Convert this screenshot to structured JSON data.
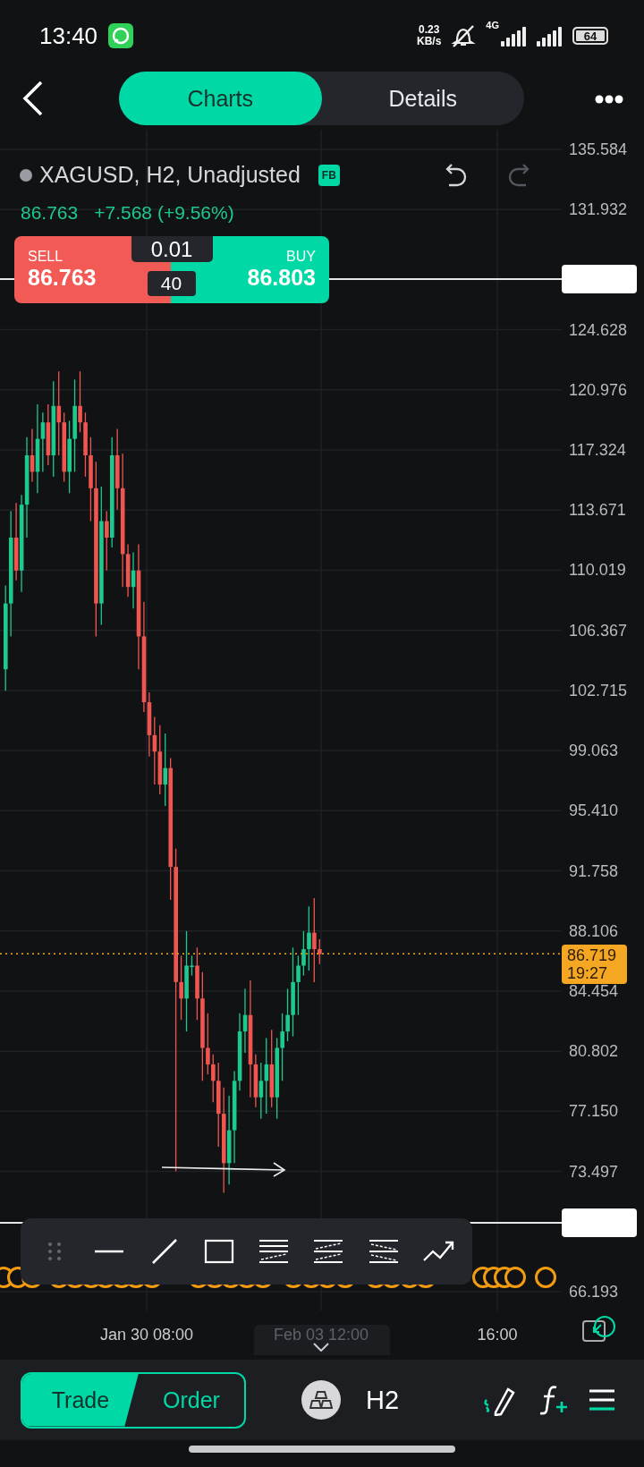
{
  "status_bar": {
    "time": "13:40",
    "net_speed": [
      "0.23",
      "KB/s"
    ],
    "network": "4G",
    "battery": "64"
  },
  "header": {
    "tabs": [
      {
        "label": "Charts",
        "selected": true
      },
      {
        "label": "Details",
        "selected": false
      }
    ]
  },
  "chart": {
    "symbol": "XAGUSD, H2, Unadjusted",
    "badge": "FB",
    "last": "86.763",
    "change": "+7.568 (+9.56%)",
    "undo_disabled": false,
    "redo_disabled": true,
    "order_panel": {
      "sell_label": "SELL",
      "sell_price": "86.763",
      "buy_label": "BUY",
      "buy_price": "86.803",
      "volume": "0.01",
      "spread": "40"
    },
    "price_axis": [
      "135.584",
      "131.932",
      "124.628",
      "120.976",
      "117.324",
      "113.671",
      "110.019",
      "106.367",
      "102.715",
      "99.063",
      "95.410",
      "91.758",
      "88.106",
      "84.454",
      "80.802",
      "77.150",
      "73.497",
      "66.193"
    ],
    "current_price": {
      "price": "86.719",
      "countdown": "19:27"
    },
    "time_axis": [
      {
        "label": "Jan 30 08:00",
        "dimmed": false
      },
      {
        "label": "Feb 03 12:00",
        "dimmed": true
      },
      {
        "label": "16:00",
        "dimmed": false
      }
    ]
  },
  "bottom_bar": {
    "modes": [
      {
        "label": "Trade",
        "selected": true
      },
      {
        "label": "Order",
        "selected": false
      }
    ],
    "timeframe": "H2"
  }
}
